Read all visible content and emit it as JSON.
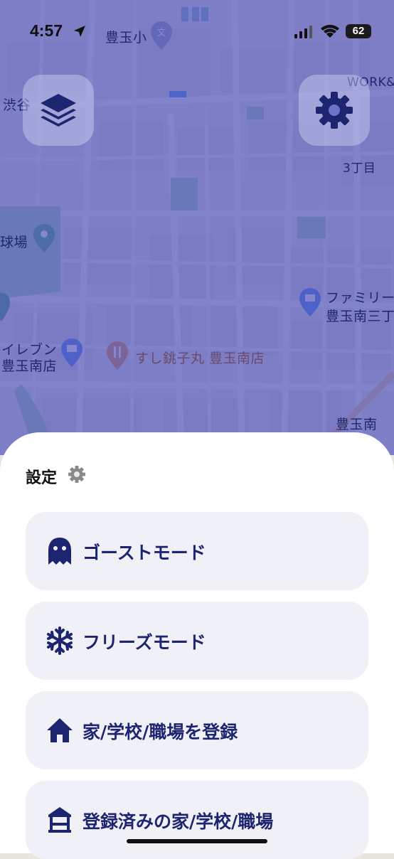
{
  "status_bar": {
    "time": "4:57",
    "battery": "62",
    "battery_level": 0.62
  },
  "map": {
    "labels": {
      "school": "豊玉小",
      "school_icon_text": "文",
      "shibuya": "渋谷",
      "work": "WORK&",
      "chome": "3丁目",
      "ballpark": "球場",
      "family1": "ファミリー",
      "family2": "豊玉南三丁",
      "eleven1": "イレブン",
      "eleven2": "豊玉南店",
      "sushi": "すし銚子丸 豊玉南店",
      "toyotama": "豊玉南"
    }
  },
  "settings": {
    "title": "設定",
    "items": [
      {
        "label": "ゴーストモード",
        "icon": "ghost-icon"
      },
      {
        "label": "フリーズモード",
        "icon": "snowflake-icon"
      },
      {
        "label": "家/学校/職場を登録",
        "icon": "home-icon"
      },
      {
        "label": "登録済みの家/学校/職場",
        "icon": "building-icon"
      }
    ]
  },
  "colors": {
    "accent": "#1e2570",
    "overlay": "#5458be",
    "card": "#f0f1f6"
  }
}
